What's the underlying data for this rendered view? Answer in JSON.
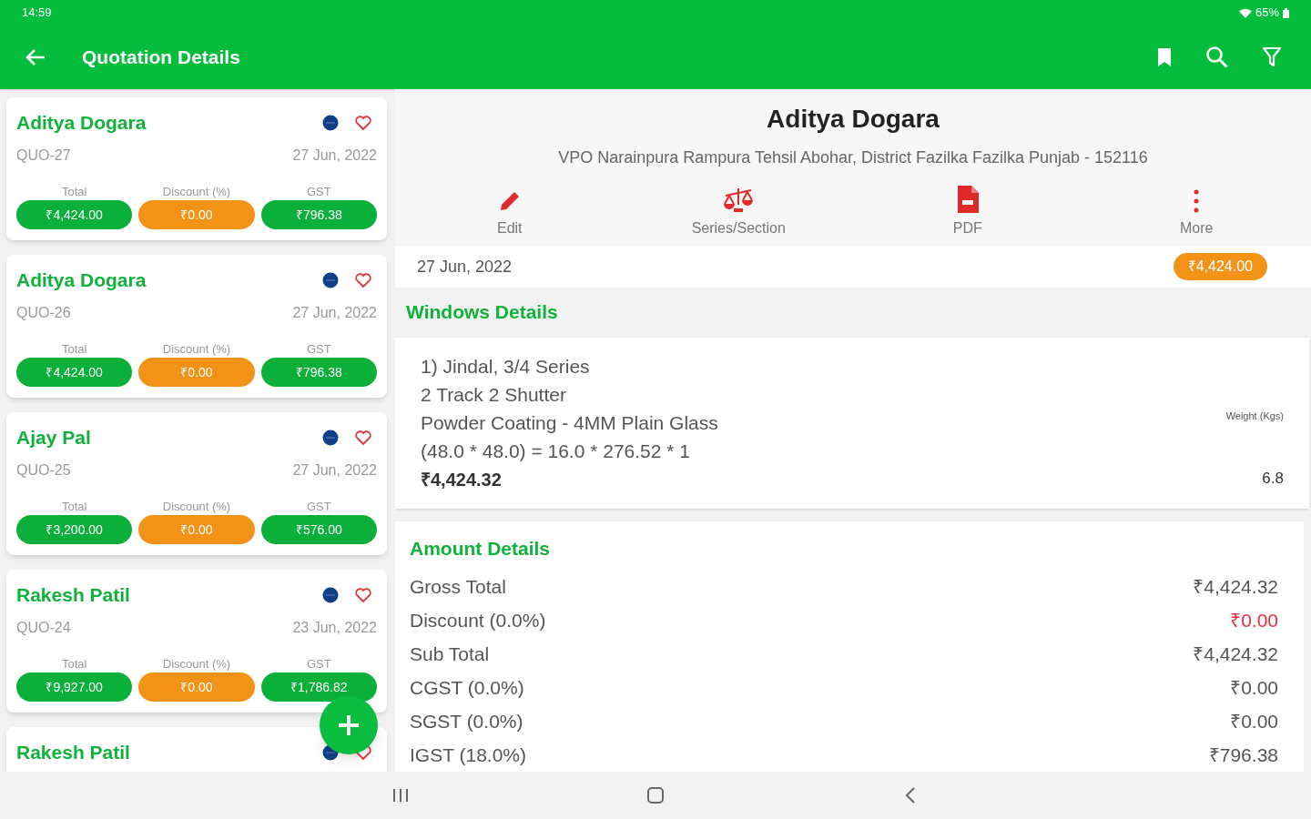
{
  "status_bar": {
    "time": "14:59",
    "battery": "65%"
  },
  "app_bar": {
    "title": "Quotation Details"
  },
  "quotations": [
    {
      "name": "Aditya Dogara",
      "number": "QUO-27",
      "date": "27 Jun, 2022",
      "favorite": false,
      "totals": [
        {
          "label": "Total",
          "value": "₹4,424.00",
          "kind": "total"
        },
        {
          "label": "Discount (%)",
          "value": "₹0.00",
          "kind": "discount"
        },
        {
          "label": "GST",
          "value": "₹796.38",
          "kind": "gst"
        }
      ]
    },
    {
      "name": "Aditya Dogara",
      "number": "QUO-26",
      "date": "27 Jun, 2022",
      "favorite": false,
      "totals": [
        {
          "label": "Total",
          "value": "₹4,424.00",
          "kind": "total"
        },
        {
          "label": "Discount (%)",
          "value": "₹0.00",
          "kind": "discount"
        },
        {
          "label": "GST",
          "value": "₹796.38",
          "kind": "gst"
        }
      ]
    },
    {
      "name": "Ajay Pal",
      "number": "QUO-25",
      "date": "27 Jun, 2022",
      "favorite": false,
      "totals": [
        {
          "label": "Total",
          "value": "₹3,200.00",
          "kind": "total"
        },
        {
          "label": "Discount (%)",
          "value": "₹0.00",
          "kind": "discount"
        },
        {
          "label": "GST",
          "value": "₹576.00",
          "kind": "gst"
        }
      ]
    },
    {
      "name": "Rakesh Patil",
      "number": "QUO-24",
      "date": "23 Jun, 2022",
      "favorite": false,
      "totals": [
        {
          "label": "Total",
          "value": "₹9,927.00",
          "kind": "total"
        },
        {
          "label": "Discount (%)",
          "value": "₹0.00",
          "kind": "discount"
        },
        {
          "label": "GST",
          "value": "₹1,786.82",
          "kind": "gst"
        }
      ]
    },
    {
      "name": "Rakesh Patil"
    }
  ],
  "detail": {
    "customer": "Aditya Dogara",
    "address": "VPO Narainpura Rampura Tehsil Abohar, District Fazilka Fazilka Punjab - 152116",
    "actions": [
      {
        "label": "Edit",
        "kind": "edit"
      },
      {
        "label": "Series/Section",
        "kind": "scales"
      },
      {
        "label": "PDF",
        "kind": "pdf"
      },
      {
        "label": "More",
        "kind": "more"
      }
    ],
    "date": "27 Jun, 2022",
    "total": "₹4,424.00",
    "windows_title": "Windows Details",
    "windows": [
      {
        "lines": [
          "1) Jindal, 3/4 Series",
          "2 Track 2 Shutter",
          "Powder Coating - 4MM Plain Glass",
          "(48.0 * 48.0) = 16.0 * 276.52 * 1"
        ],
        "price": "₹4,424.32",
        "weight_label": "Weight (Kgs)",
        "weight": "6.8"
      }
    ],
    "amount_title": "Amount Details",
    "amounts": [
      {
        "label": "Gross Total",
        "value": "₹4,424.32",
        "kind": "amount"
      },
      {
        "label": "Discount (0.0%)",
        "value": "₹0.00",
        "kind": "deduction"
      },
      {
        "label": "Sub Total",
        "value": "₹4,424.32",
        "kind": "amount"
      },
      {
        "label": "CGST (0.0%)",
        "value": "₹0.00",
        "kind": "amount"
      },
      {
        "label": "SGST (0.0%)",
        "value": "₹0.00",
        "kind": "amount"
      },
      {
        "label": "IGST (18.0%)",
        "value": "₹796.38",
        "kind": "amount"
      }
    ]
  }
}
